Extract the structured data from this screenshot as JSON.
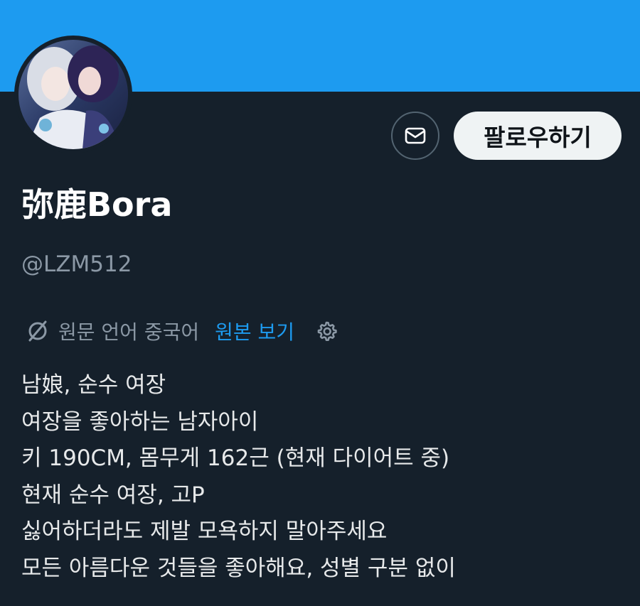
{
  "profile": {
    "display_name": "弥鹿Bora",
    "handle": "@LZM512",
    "avatar_icon": "avatar-image"
  },
  "actions": {
    "message_icon": "envelope-icon",
    "follow_label": "팔로우하기"
  },
  "translation": {
    "icon": "translate-off-icon",
    "source_language_text": "원문 언어 중국어",
    "show_original_label": "원본 보기",
    "settings_icon": "gear-icon"
  },
  "bio": {
    "lines": [
      "남娘, 순수 여장",
      "여장을 좋아하는 남자아이",
      "키 190CM, 몸무게 162근 (현재 다이어트 중)",
      "현재 순수 여장, 고P",
      "싫어하더라도 제발 모욕하지 말아주세요",
      "모든 아름다운 것들을 좋아해요, 성별 구분 없이"
    ]
  },
  "colors": {
    "banner": "#1d9bf0",
    "background": "#15202b",
    "accent_link": "#1d9bf0",
    "secondary_text": "#8b98a5"
  }
}
